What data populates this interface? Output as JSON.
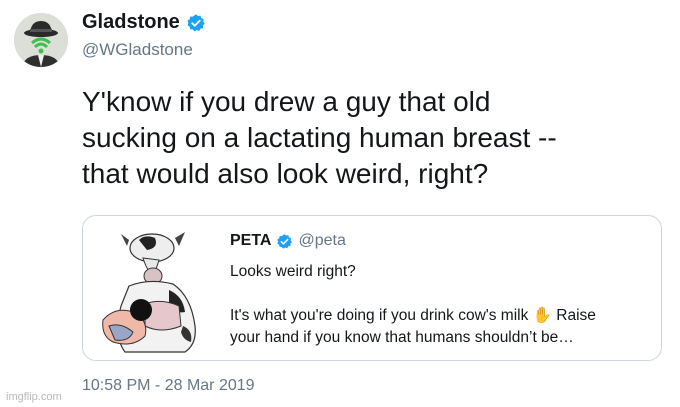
{
  "author": {
    "name": "Gladstone",
    "handle": "@WGladstone",
    "verified": true
  },
  "tweet": {
    "lines": [
      "Y'know if you drew a guy that old",
      "sucking on a lactating human breast --",
      "that would also look weird, right?"
    ],
    "timestamp": "10:58 PM - 28 Mar 2019"
  },
  "quoted_tweet": {
    "name": "PETA",
    "handle": "@peta",
    "verified": true,
    "line1": "Looks weird right?",
    "line2a": "It's what you're doing if you drink cow's milk",
    "line2b": " Raise",
    "line3": "your hand if you know that humans shouldn’t be…",
    "emoji": "✋"
  },
  "watermark": "imgflip.com",
  "colors": {
    "verified": "#1da1f2",
    "secondary_text": "#657786",
    "border": "#ccd6dd"
  }
}
